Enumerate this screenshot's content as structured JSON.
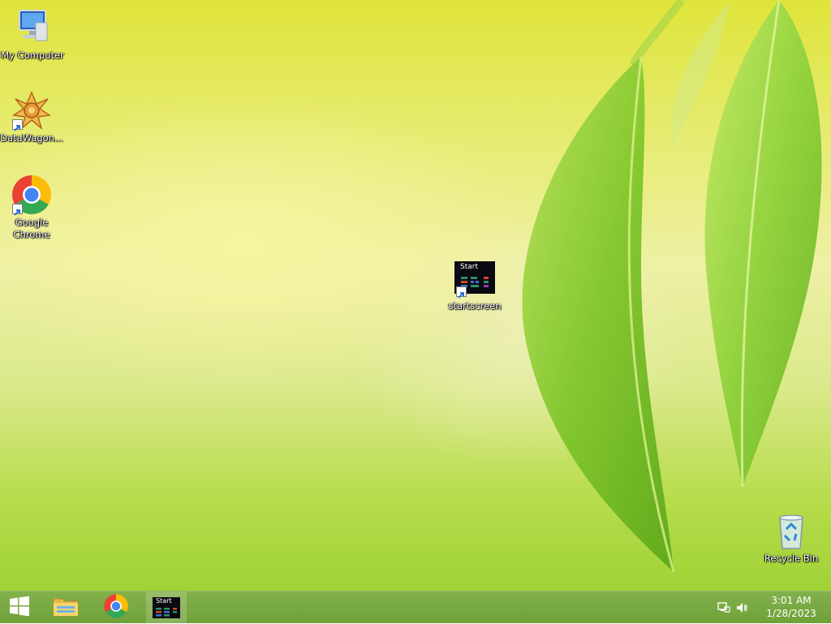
{
  "desktop": {
    "icons": [
      {
        "label": "My Computer",
        "icon": "computer-icon",
        "shortcut": false
      },
      {
        "label": "DataWagon...",
        "icon": "datawagon-icon",
        "shortcut": true
      },
      {
        "label": "Google Chrome",
        "icon": "chrome-icon",
        "shortcut": true
      },
      {
        "label": "startscreen",
        "icon": "startscreen-icon",
        "shortcut": true,
        "tile_text": "Start"
      },
      {
        "label": "Recycle Bin",
        "icon": "recycle-bin-icon",
        "shortcut": false
      }
    ]
  },
  "taskbar": {
    "start_icon": "windows-logo-icon",
    "pinned": [
      {
        "name": "File Explorer",
        "icon": "file-explorer-icon"
      },
      {
        "name": "Google Chrome",
        "icon": "chrome-icon"
      },
      {
        "name": "startscreen",
        "icon": "startscreen-icon",
        "tile_text": "Start",
        "active": true
      }
    ],
    "tray": {
      "icons": [
        "network-icon",
        "speaker-icon"
      ],
      "time": "3:01 AM",
      "date": "1/28/2023"
    }
  },
  "colors": {
    "taskbar": "#6f9f37",
    "wallpaper_top": "#dfe43a",
    "wallpaper_bottom": "#9fd236",
    "leaf": "#86c92b"
  }
}
